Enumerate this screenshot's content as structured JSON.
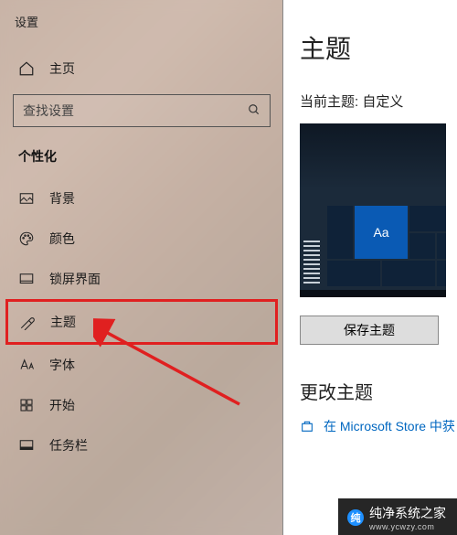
{
  "app_title": "设置",
  "home_label": "主页",
  "search": {
    "placeholder": "查找设置"
  },
  "section_header": "个性化",
  "sidebar_items": [
    {
      "label": "背景",
      "icon": "image-icon"
    },
    {
      "label": "颜色",
      "icon": "palette-icon"
    },
    {
      "label": "锁屏界面",
      "icon": "lockscreen-icon"
    },
    {
      "label": "主题",
      "icon": "theme-icon",
      "highlighted": true
    },
    {
      "label": "字体",
      "icon": "font-icon"
    },
    {
      "label": "开始",
      "icon": "start-icon"
    },
    {
      "label": "任务栏",
      "icon": "taskbar-icon"
    }
  ],
  "content": {
    "heading": "主题",
    "current_theme_label": "当前主题: 自定义",
    "preview_tile_text": "Aa",
    "save_button": "保存主题",
    "change_heading": "更改主题",
    "store_link": "在 Microsoft Store 中获"
  },
  "watermark": {
    "name": "纯净系统之家",
    "url": "www.ycwzy.com"
  }
}
